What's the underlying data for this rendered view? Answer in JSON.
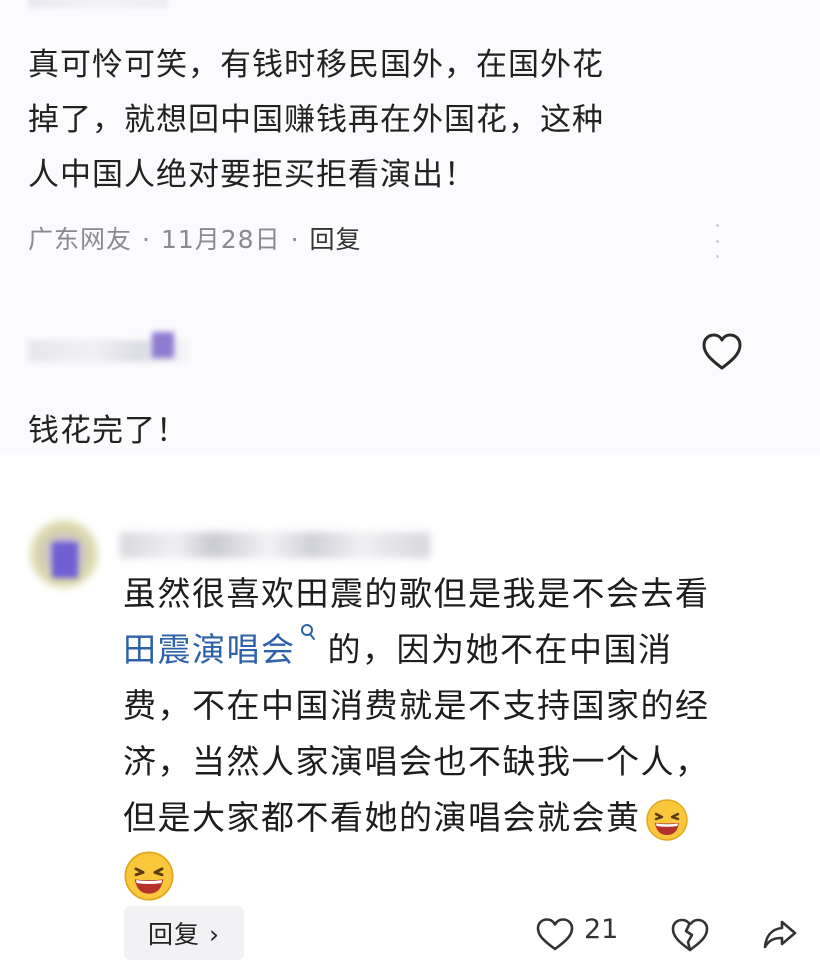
{
  "comment1": {
    "lines": [
      "真可怜可笑，有钱时移民国外，在国外花",
      "掉了，就想回中国赚钱再在外国花，这种",
      "人中国人绝对要拒买拒看演出！"
    ],
    "location": "广东网友",
    "date": "11月28日",
    "reply_label": "回复"
  },
  "reply1": {
    "text": "钱花完了！"
  },
  "comment2": {
    "segments": [
      "虽然很喜欢田震的歌但是我是不会去看",
      "田震演唱会",
      " 的，因为她不在中国消",
      "费，不在中国消费就是不支持国家的经",
      "济，当然人家演唱会也不缺我一个人，",
      "但是大家都不看她的演唱会就会黄"
    ],
    "reply_button": "回复 ›",
    "like_count": "21"
  },
  "icons": {
    "like": "heart-icon",
    "dislike": "broken-heart-icon",
    "share": "share-arrow-icon",
    "search": "search-icon",
    "emoji": "laughing-emoji-icon"
  },
  "colors": {
    "link": "#2e62a8",
    "meta": "#8b8b8f"
  }
}
